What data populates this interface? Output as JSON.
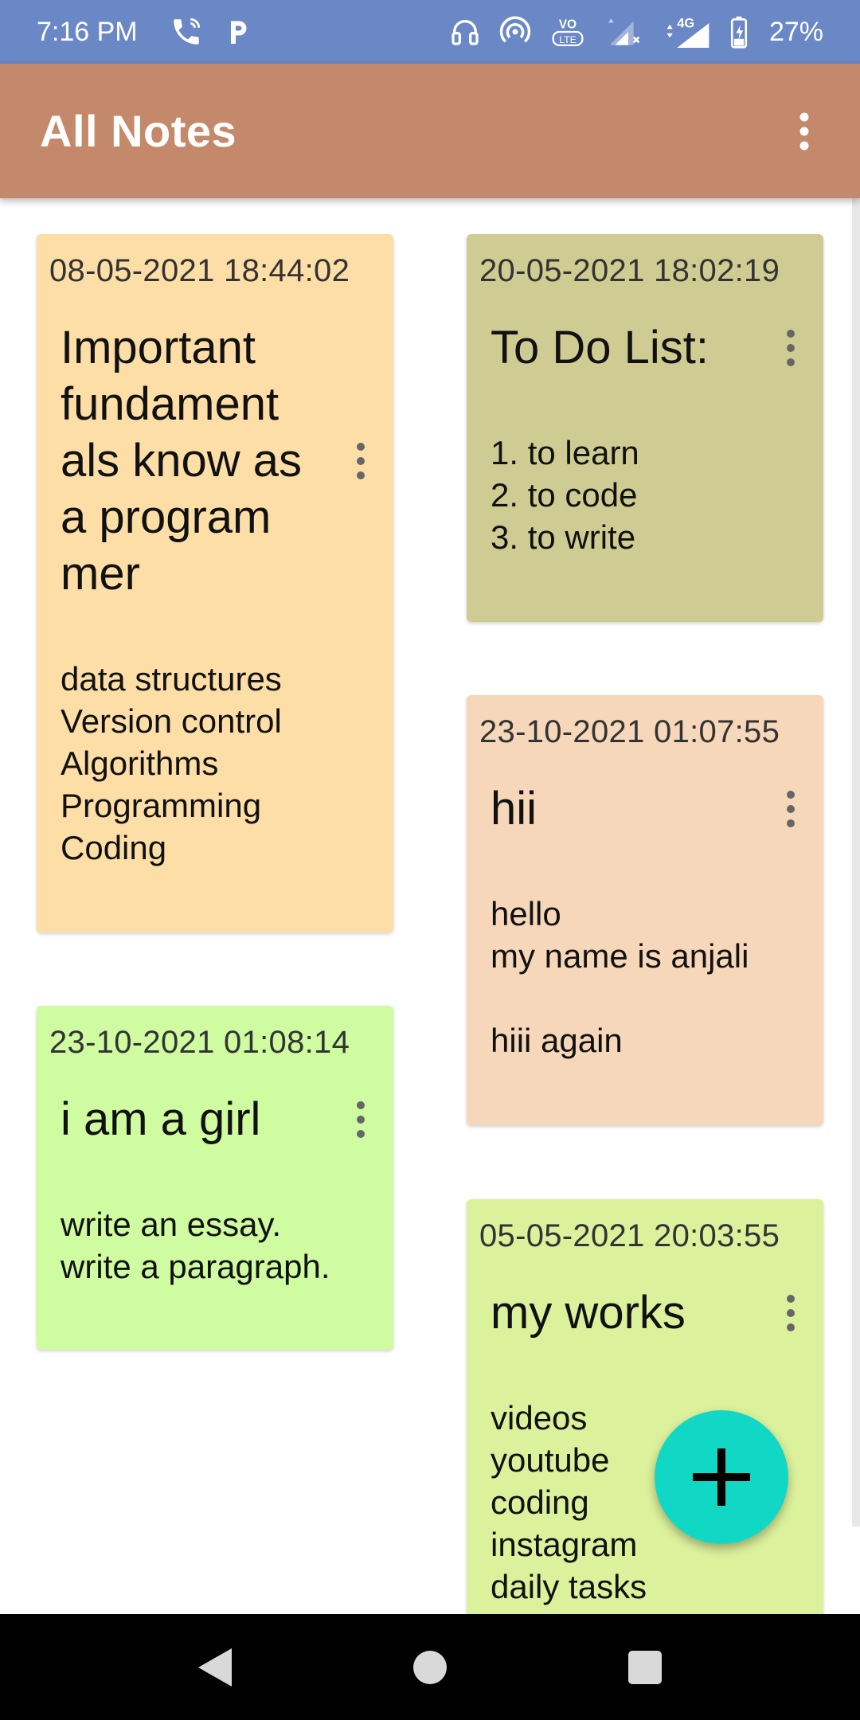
{
  "status_bar": {
    "time": "7:16 PM",
    "battery": "27%",
    "network": "4G",
    "volte": "VO LTE",
    "icons": [
      "wifi-calling-icon",
      "parking-app-icon",
      "headset-icon",
      "hotspot-icon",
      "volte-icon",
      "signal-icon",
      "signal-4g-icon",
      "battery-icon"
    ]
  },
  "app_bar": {
    "title": "All Notes",
    "menu_icon": "more-vert-icon",
    "color": "#c4896a"
  },
  "notes": [
    {
      "date": "08-05-2021 18:44:02",
      "title": "Important fundament als know as a program mer",
      "body": "data structures\nVersion control\nAlgorithms\nProgramming\nCoding",
      "color": "#fddea7"
    },
    {
      "date": "20-05-2021 18:02:19",
      "title": "To Do List:",
      "body": "1. to learn\n2. to code\n3. to write",
      "color": "#cfcc93"
    },
    {
      "date": "23-10-2021 01:07:55",
      "title": "hii",
      "body": "hello\nmy name is anjali\n\nhiii again",
      "color": "#f6d7b9"
    },
    {
      "date": "23-10-2021 01:08:14",
      "title": "i am a girl",
      "body": "write an essay.\nwrite a paragraph.",
      "color": "#cffca0"
    },
    {
      "date": "05-05-2021 20:03:55",
      "title": "my works",
      "body": "videos\nyoutube\ncoding\ninstagram\ndaily tasks",
      "color": "#dcf19c"
    }
  ],
  "fab": {
    "icon": "add-icon",
    "color": "#11d8c5"
  },
  "nav_bar": {
    "icons": [
      "back-icon",
      "home-icon",
      "recents-icon"
    ]
  }
}
